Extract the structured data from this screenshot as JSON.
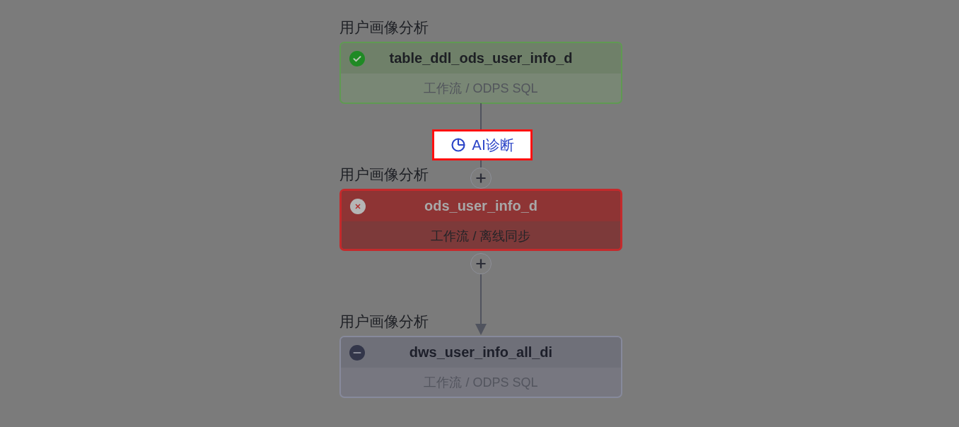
{
  "nodes": [
    {
      "group": "用户画像分析",
      "name": "table_ddl_ods_user_info_d",
      "subtitle": "工作流 / ODPS SQL",
      "kind": "success",
      "selected": false
    },
    {
      "group": "用户画像分析",
      "name": "ods_user_info_d",
      "subtitle": "工作流 / 离线同步",
      "kind": "failed",
      "selected": true
    },
    {
      "group": "用户画像分析",
      "name": "dws_user_info_all_di",
      "subtitle": "工作流 / ODPS SQL",
      "kind": "disabled",
      "selected": false
    }
  ],
  "ai_button": {
    "label": "AI诊断",
    "highlighted": true
  }
}
